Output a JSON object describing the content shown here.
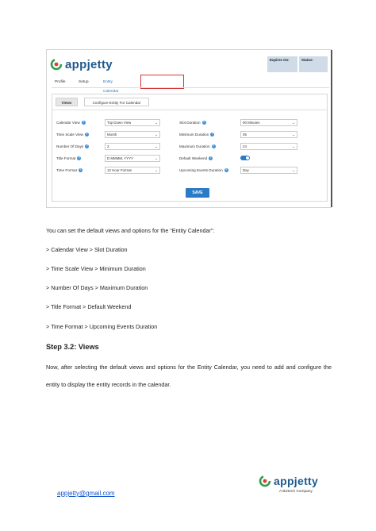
{
  "app": {
    "brand": "appjetty",
    "expires_label": "Expires On:",
    "status_label": "Status:",
    "colors": {
      "brand": "#1d5a8c",
      "accent": "#2a7ac8",
      "highlight": "#d23a3a",
      "logo_green": "#2e9e4a",
      "logo_red": "#e23b3b"
    }
  },
  "tabs": [
    {
      "label": "Profile"
    },
    {
      "label": "Setup"
    },
    {
      "label": "Entity Calendar",
      "active": true
    }
  ],
  "subtabs": [
    {
      "label": "Views",
      "active": true
    },
    {
      "label": "Configure Entity For Calendar"
    }
  ],
  "form": {
    "left": [
      {
        "label": "Calendar View",
        "value": "Top Down View"
      },
      {
        "label": "Time Scale View",
        "value": "Month"
      },
      {
        "label": "Number Of Days",
        "value": "2"
      },
      {
        "label": "Title Format",
        "value": "D MMMM, YYYY"
      },
      {
        "label": "Time Format",
        "value": "12 Hour Format"
      }
    ],
    "right": [
      {
        "label": "Slot Duration",
        "value": "90 Minutes"
      },
      {
        "label": "Minimum Duration",
        "value": "05"
      },
      {
        "label": "Maximum Duration",
        "value": "24"
      },
      {
        "label": "Default Weekend",
        "toggle": true
      },
      {
        "label": "Upcoming Events Duration",
        "value": "Day"
      }
    ],
    "save_label": "SAVE",
    "help_glyph": "?",
    "chevron_glyph": "⌄"
  },
  "document": {
    "intro": "You can set the default views and options for the “Entity Calendar”:",
    "steps": [
      "> Calendar View > Slot Duration",
      "> Time Scale View > Minimum Duration",
      "> Number Of Days > Maximum Duration",
      "> Title Format > Default Weekend",
      "> Time Format > Upcoming Events Duration"
    ],
    "heading": "Step 3.2: Views",
    "body": "Now, after selecting the default views and options for the Entity Calendar, you need to add and configure the entity to display the entity records in the calendar."
  },
  "footer": {
    "email": "appjetty@gmail.com",
    "brand": "appjetty",
    "tagline": "A Biztech Company"
  }
}
